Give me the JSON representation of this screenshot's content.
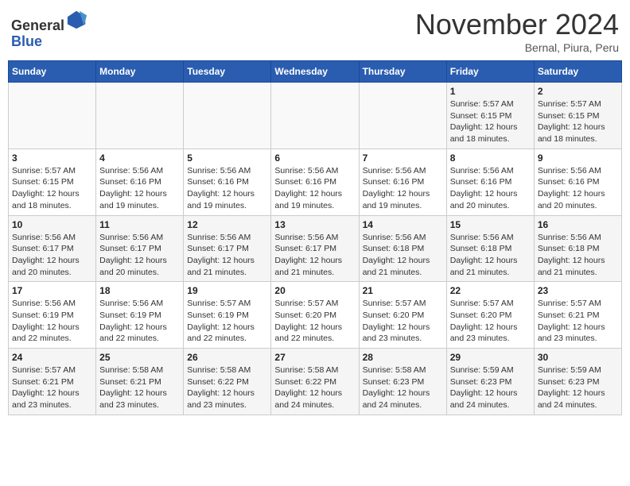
{
  "header": {
    "logo_general": "General",
    "logo_blue": "Blue",
    "month_title": "November 2024",
    "subtitle": "Bernal, Piura, Peru"
  },
  "calendar": {
    "days_of_week": [
      "Sunday",
      "Monday",
      "Tuesday",
      "Wednesday",
      "Thursday",
      "Friday",
      "Saturday"
    ],
    "weeks": [
      [
        {
          "day": "",
          "info": ""
        },
        {
          "day": "",
          "info": ""
        },
        {
          "day": "",
          "info": ""
        },
        {
          "day": "",
          "info": ""
        },
        {
          "day": "",
          "info": ""
        },
        {
          "day": "1",
          "info": "Sunrise: 5:57 AM\nSunset: 6:15 PM\nDaylight: 12 hours and 18 minutes."
        },
        {
          "day": "2",
          "info": "Sunrise: 5:57 AM\nSunset: 6:15 PM\nDaylight: 12 hours and 18 minutes."
        }
      ],
      [
        {
          "day": "3",
          "info": "Sunrise: 5:57 AM\nSunset: 6:15 PM\nDaylight: 12 hours and 18 minutes."
        },
        {
          "day": "4",
          "info": "Sunrise: 5:56 AM\nSunset: 6:16 PM\nDaylight: 12 hours and 19 minutes."
        },
        {
          "day": "5",
          "info": "Sunrise: 5:56 AM\nSunset: 6:16 PM\nDaylight: 12 hours and 19 minutes."
        },
        {
          "day": "6",
          "info": "Sunrise: 5:56 AM\nSunset: 6:16 PM\nDaylight: 12 hours and 19 minutes."
        },
        {
          "day": "7",
          "info": "Sunrise: 5:56 AM\nSunset: 6:16 PM\nDaylight: 12 hours and 19 minutes."
        },
        {
          "day": "8",
          "info": "Sunrise: 5:56 AM\nSunset: 6:16 PM\nDaylight: 12 hours and 20 minutes."
        },
        {
          "day": "9",
          "info": "Sunrise: 5:56 AM\nSunset: 6:16 PM\nDaylight: 12 hours and 20 minutes."
        }
      ],
      [
        {
          "day": "10",
          "info": "Sunrise: 5:56 AM\nSunset: 6:17 PM\nDaylight: 12 hours and 20 minutes."
        },
        {
          "day": "11",
          "info": "Sunrise: 5:56 AM\nSunset: 6:17 PM\nDaylight: 12 hours and 20 minutes."
        },
        {
          "day": "12",
          "info": "Sunrise: 5:56 AM\nSunset: 6:17 PM\nDaylight: 12 hours and 21 minutes."
        },
        {
          "day": "13",
          "info": "Sunrise: 5:56 AM\nSunset: 6:17 PM\nDaylight: 12 hours and 21 minutes."
        },
        {
          "day": "14",
          "info": "Sunrise: 5:56 AM\nSunset: 6:18 PM\nDaylight: 12 hours and 21 minutes."
        },
        {
          "day": "15",
          "info": "Sunrise: 5:56 AM\nSunset: 6:18 PM\nDaylight: 12 hours and 21 minutes."
        },
        {
          "day": "16",
          "info": "Sunrise: 5:56 AM\nSunset: 6:18 PM\nDaylight: 12 hours and 21 minutes."
        }
      ],
      [
        {
          "day": "17",
          "info": "Sunrise: 5:56 AM\nSunset: 6:19 PM\nDaylight: 12 hours and 22 minutes."
        },
        {
          "day": "18",
          "info": "Sunrise: 5:56 AM\nSunset: 6:19 PM\nDaylight: 12 hours and 22 minutes."
        },
        {
          "day": "19",
          "info": "Sunrise: 5:57 AM\nSunset: 6:19 PM\nDaylight: 12 hours and 22 minutes."
        },
        {
          "day": "20",
          "info": "Sunrise: 5:57 AM\nSunset: 6:20 PM\nDaylight: 12 hours and 22 minutes."
        },
        {
          "day": "21",
          "info": "Sunrise: 5:57 AM\nSunset: 6:20 PM\nDaylight: 12 hours and 23 minutes."
        },
        {
          "day": "22",
          "info": "Sunrise: 5:57 AM\nSunset: 6:20 PM\nDaylight: 12 hours and 23 minutes."
        },
        {
          "day": "23",
          "info": "Sunrise: 5:57 AM\nSunset: 6:21 PM\nDaylight: 12 hours and 23 minutes."
        }
      ],
      [
        {
          "day": "24",
          "info": "Sunrise: 5:57 AM\nSunset: 6:21 PM\nDaylight: 12 hours and 23 minutes."
        },
        {
          "day": "25",
          "info": "Sunrise: 5:58 AM\nSunset: 6:21 PM\nDaylight: 12 hours and 23 minutes."
        },
        {
          "day": "26",
          "info": "Sunrise: 5:58 AM\nSunset: 6:22 PM\nDaylight: 12 hours and 23 minutes."
        },
        {
          "day": "27",
          "info": "Sunrise: 5:58 AM\nSunset: 6:22 PM\nDaylight: 12 hours and 24 minutes."
        },
        {
          "day": "28",
          "info": "Sunrise: 5:58 AM\nSunset: 6:23 PM\nDaylight: 12 hours and 24 minutes."
        },
        {
          "day": "29",
          "info": "Sunrise: 5:59 AM\nSunset: 6:23 PM\nDaylight: 12 hours and 24 minutes."
        },
        {
          "day": "30",
          "info": "Sunrise: 5:59 AM\nSunset: 6:23 PM\nDaylight: 12 hours and 24 minutes."
        }
      ]
    ]
  }
}
